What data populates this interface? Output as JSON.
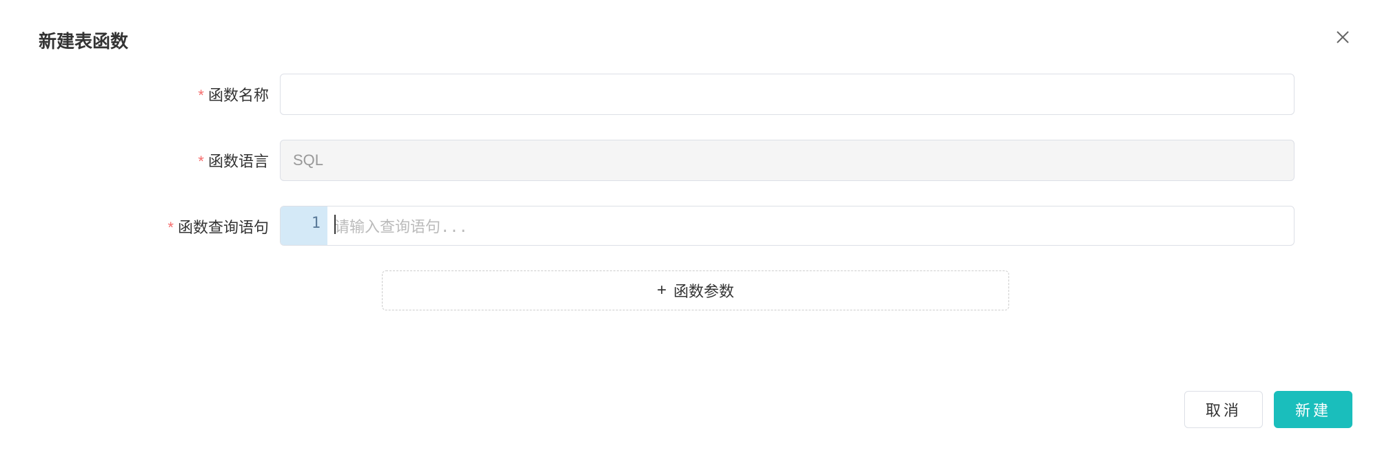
{
  "modal": {
    "title": "新建表函数",
    "close_label": "关闭"
  },
  "form": {
    "name": {
      "label": "函数名称",
      "value": ""
    },
    "language": {
      "label": "函数语言",
      "value": "SQL"
    },
    "query": {
      "label": "函数查询语句",
      "line_number": "1",
      "placeholder": "请输入查询语句..."
    },
    "add_params": {
      "label": "函数参数"
    }
  },
  "footer": {
    "cancel_label": "取消",
    "confirm_label": "新建"
  }
}
